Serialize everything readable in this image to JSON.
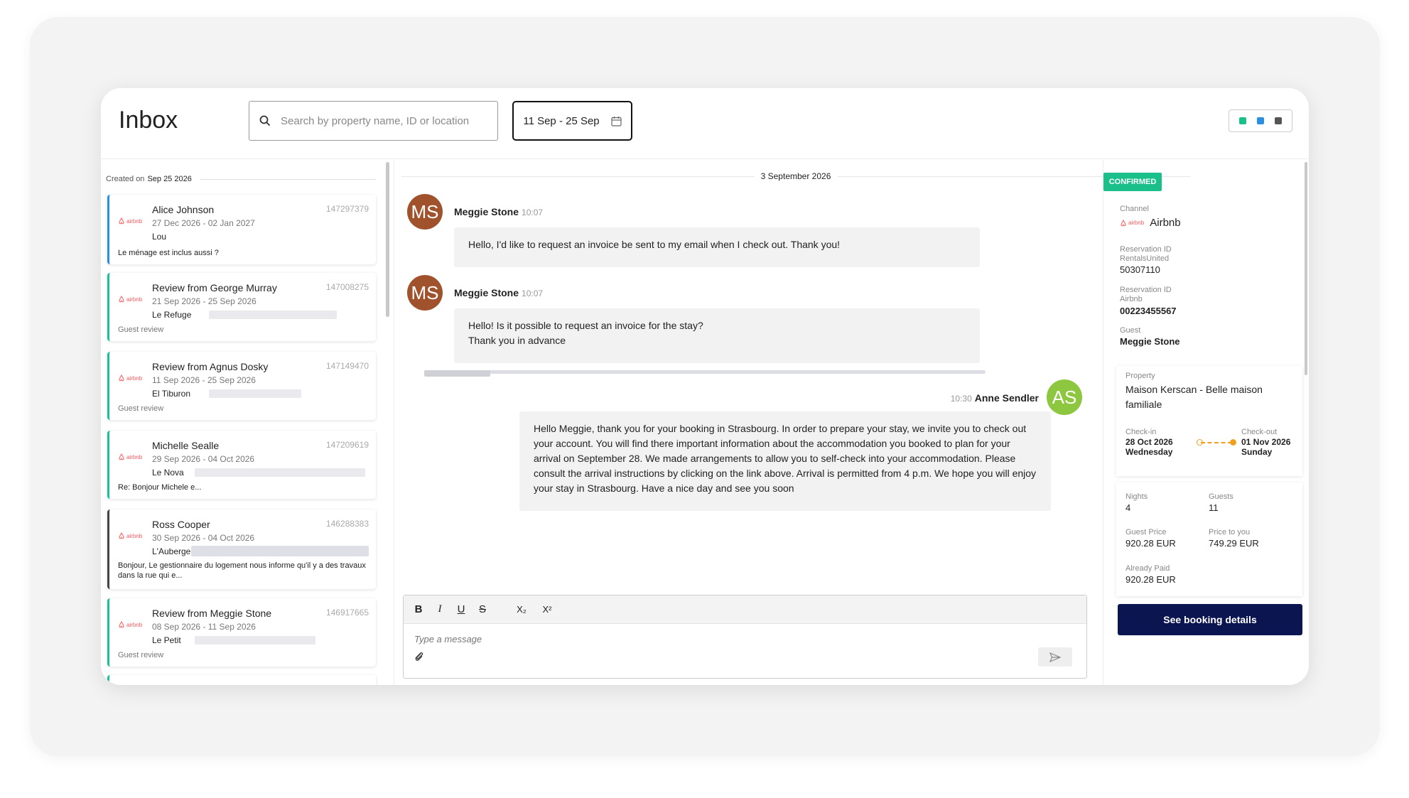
{
  "header": {
    "title": "Inbox",
    "search_placeholder": "Search by property name, ID or location",
    "date_range": "11 Sep - 25 Sep",
    "view_colors": [
      "#1bbf8a",
      "#2a8fe0",
      "#555555"
    ]
  },
  "list": {
    "created_label": "Created on",
    "created_date": "Sep 25 2026",
    "items": [
      {
        "name": "Alice Johnson",
        "id": "147297379",
        "dates": "27 Dec 2026 - 02 Jan 2027",
        "property": "Lou",
        "message": "Le ménage est inclus aussi ?",
        "channel": "airbnb"
      },
      {
        "name": "Review from George Murray",
        "id": "147008275",
        "dates": "21 Sep 2026 - 25 Sep 2026",
        "property": "Le Refuge",
        "message": "Guest review",
        "channel": "airbnb"
      },
      {
        "name": "Review from Agnus Dosky",
        "id": "147149470",
        "dates": "11 Sep 2026 - 25 Sep 2026",
        "property": "El Tiburon",
        "message": "Guest review",
        "channel": "airbnb"
      },
      {
        "name": "Michelle Sealle",
        "id": "147209619",
        "dates": "29 Sep 2026 - 04 Oct 2026",
        "property": "Le Nova",
        "message": "Re: Bonjour Michele e...",
        "channel": "airbnb"
      },
      {
        "name": "Ross Cooper",
        "id": "146288383",
        "dates": "30 Sep 2026 - 04 Oct 2026",
        "property": "L'Auberge",
        "message": "Bonjour, Le gestionnaire du logement nous informe qu'il y a des travaux dans la rue qui e...",
        "channel": "airbnb"
      },
      {
        "name": "Review from Meggie Stone",
        "id": "146917665",
        "dates": "08 Sep 2026 - 11 Sep 2026",
        "property": "Le Petit",
        "message": "Guest review",
        "channel": "airbnb"
      }
    ]
  },
  "chat": {
    "day": "3 September 2026",
    "messages": [
      {
        "initials": "MS",
        "sender": "Meggie Stone",
        "time": "10:07",
        "lines": [
          "Hello, I'd like to request an invoice be sent to my email when I check out. Thank you!"
        ]
      },
      {
        "initials": "MS",
        "sender": "Meggie Stone",
        "time": "10:07",
        "lines": [
          "Hello! Is it possible to request an invoice for the stay?",
          "Thank you in advance"
        ]
      },
      {
        "initials": "AS",
        "sender": "Anne Sendler",
        "time": "10:30",
        "lines": [
          "Hello Meggie, thank you for your booking in Strasbourg. In order to prepare your stay, we invite you to check out",
          "your account. You will find there important information about the accommodation you booked to plan for your",
          "arrival on September 28. We made arrangements to allow you to self-check into your accommodation. Please",
          "consult the arrival instructions by clicking on the link above. Arrival is permitted from 4 p.m. We hope you will enjoy",
          "your stay in Strasbourg. Have a nice day and see you soon"
        ]
      }
    ],
    "avatar_colors": {
      "guest": "#a0522d",
      "host": "#8dc63f"
    },
    "composer": {
      "placeholder": "Type a message",
      "tools": [
        "B",
        "I",
        "U",
        "S",
        "X₂",
        "X²"
      ]
    }
  },
  "booking": {
    "status": "CONFIRMED",
    "status_color": "#1bbf8a",
    "channel_label": "Channel",
    "channel": "Airbnb",
    "res_id_label_1": "Reservation ID",
    "res_id_source_1": "RentalsUnited",
    "res_id_1": "50307110",
    "res_id_label_2": "Reservation ID",
    "res_id_source_2": "Airbnb",
    "res_id_2": "00223455567",
    "guest_label": "Guest",
    "guest": "Meggie Stone",
    "property_label": "Property",
    "property_name": "Maison Kerscan - Belle maison familiale",
    "checkin_label": "Check-in",
    "checkin_date": "28 Oct 2026",
    "checkin_day": "Wednesday",
    "checkout_label": "Check-out",
    "checkout_date": "01 Nov 2026",
    "checkout_day": "Sunday",
    "nights_label": "Nights",
    "nights": "4",
    "guests_label": "Guests",
    "guests": "11",
    "guest_price_label": "Guest Price",
    "guest_price": "920.28 EUR",
    "price_to_you_label": "Price to you",
    "price_to_you": "749.29 EUR",
    "already_paid_label": "Already Paid",
    "already_paid": "920.28 EUR",
    "cta": "See booking details"
  }
}
